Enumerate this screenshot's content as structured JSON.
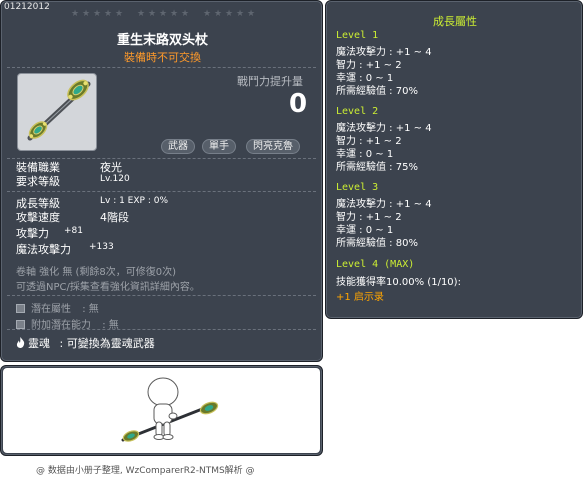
{
  "item": {
    "code": "01212012",
    "name": "重生末路双头杖",
    "trade_note": "裝備時不可交換",
    "power_label": "戰鬥力提升量",
    "power_value": "0",
    "tags": [
      "武器",
      "單手",
      "閃亮克魯"
    ],
    "job_label": "裝備職業",
    "job_value": "夜光",
    "req_level_label": "要求等級",
    "req_level_value": "Lv.120",
    "growth_label": "成長等級",
    "growth_value": "Lv : 1   EXP : 0%",
    "speed_label": "攻擊速度",
    "speed_value": "4階段",
    "atk_label": "攻擊力",
    "atk_value": "+81",
    "matk_label": "魔法攻擊力",
    "matk_value": "+133",
    "scroll_line": "卷軸 強化 無 (剩餘8次，可修復0次)",
    "npc_line": "可透過NPC/採集查看強化資訊詳細內容。",
    "potential_label": "潛在屬性",
    "potential_value": ": 無",
    "add_potential_label": "附加潛在能力",
    "add_potential_value": ": 無",
    "soul_label": "靈魂",
    "soul_value": ": 可變換為靈魂武器"
  },
  "growth": {
    "title": "成長屬性",
    "levels": [
      {
        "title": "Level 1",
        "lines": [
          "魔法攻擊力 : +1 ~ 4",
          "智力 : +1 ~ 2",
          "幸運 : 0 ~ 1",
          "所需經驗值 : 70%"
        ]
      },
      {
        "title": "Level 2",
        "lines": [
          "魔法攻擊力 : +1 ~ 4",
          "智力 : +1 ~ 2",
          "幸運 : 0 ~ 1",
          "所需經驗值 : 75%"
        ]
      },
      {
        "title": "Level 3",
        "lines": [
          "魔法攻擊力 : +1 ~ 4",
          "智力 : +1 ~ 2",
          "幸運 : 0 ~ 1",
          "所需經驗值 : 80%"
        ]
      },
      {
        "title": "Level 4 (MAX)",
        "lines": [
          "技能獲得率10.00% (1/10):"
        ]
      }
    ],
    "extra": "+1 启示录"
  },
  "footer": "@ 数据由小册子整理, WzComparerR2-NTMS解析 @",
  "colors": {
    "panel_bg": "#3c434e",
    "trade_note": "#ff9a2a",
    "growth_level": "#ccee33",
    "extra": "#ffa500"
  }
}
